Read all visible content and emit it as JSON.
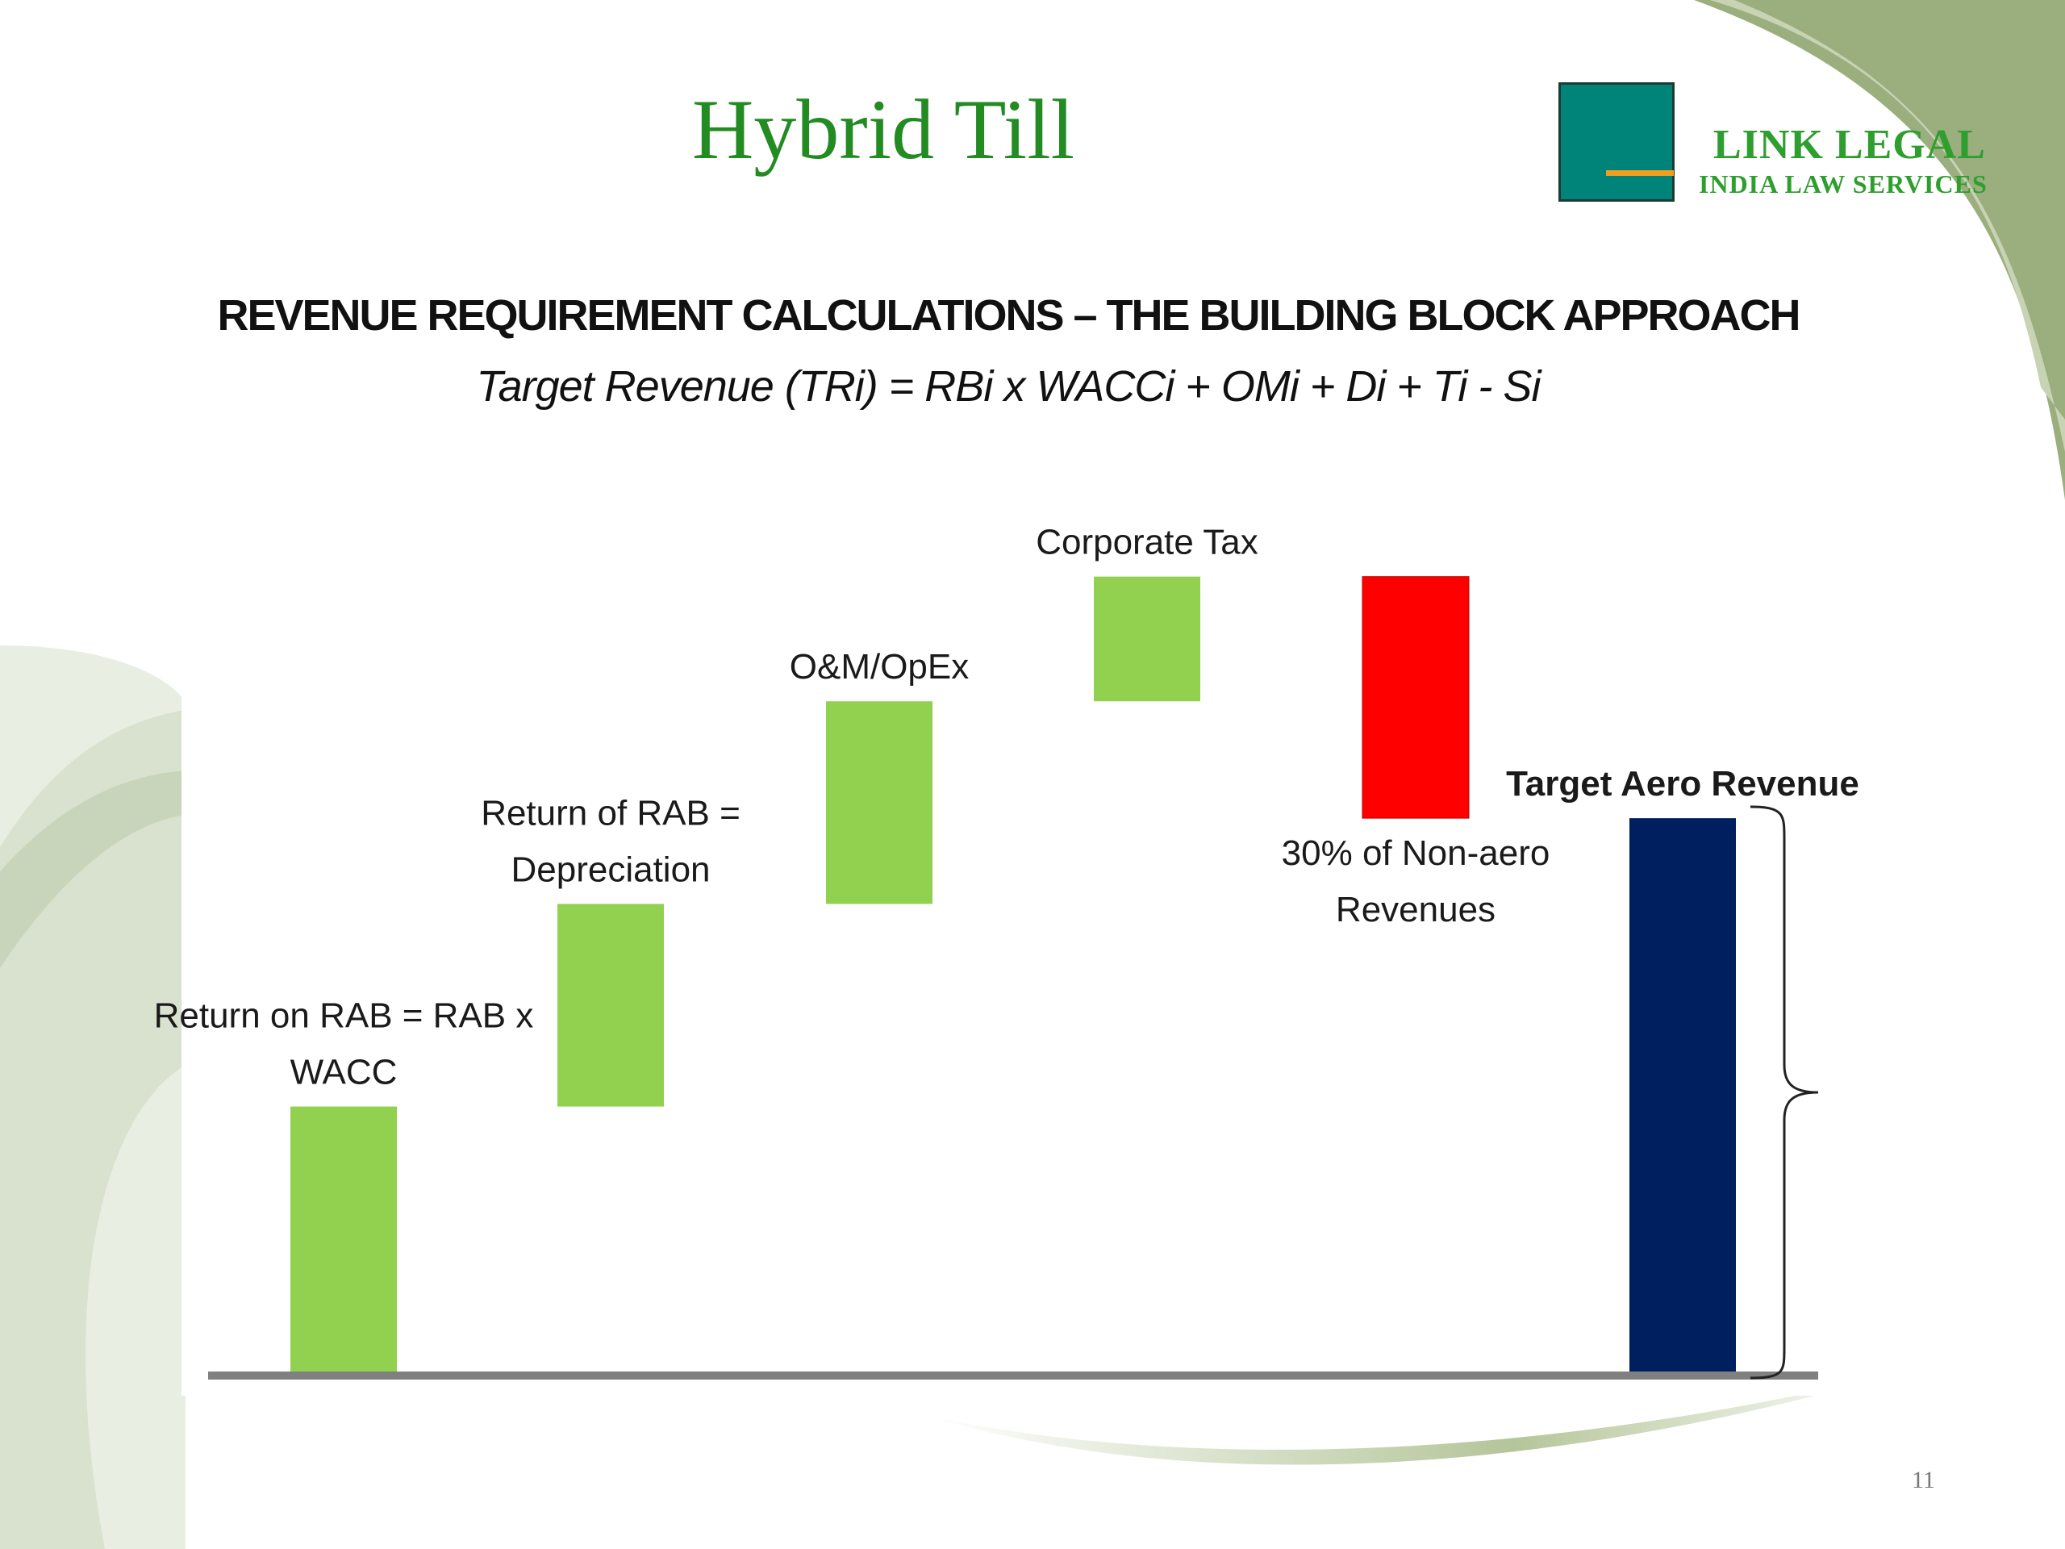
{
  "slide": {
    "title": "Hybrid Till",
    "page_number": "11"
  },
  "brand": {
    "name": "LINK LEGAL",
    "subtitle": "INDIA LAW  SERVICES"
  },
  "colors": {
    "title_green": "#228b22",
    "bar_green": "#92d050",
    "bar_red": "#ff0000",
    "bar_navy": "#001f5f",
    "baseline": "#808080"
  },
  "chart_data": {
    "type": "bar",
    "subtype": "waterfall",
    "title": "REVENUE REQUIREMENT CALCULATIONS – THE BUILDING BLOCK APPROACH",
    "subtitle": "Target Revenue  (TRi) = RBi x WACCi + OMi + Di + Ti - Si",
    "xlabel": "",
    "ylabel": "",
    "ylim": [
      0,
      100
    ],
    "grid": false,
    "legend": "none",
    "categories": [
      "Return on RAB = RAB x WACC",
      "Return of RAB = Depreciation",
      "O&M/OpEx",
      "Corporate Tax",
      "30% of Non-aero Revenues",
      "Target Aero Revenue"
    ],
    "label_lines": [
      [
        "Return on RAB = RAB x",
        "WACC"
      ],
      [
        "Return of RAB =",
        "Depreciation"
      ],
      [
        "O&M/OpEx"
      ],
      [
        "Corporate Tax"
      ],
      [
        "30% of Non-aero",
        "Revenues"
      ],
      [
        "Target Aero Revenue"
      ]
    ],
    "label_position": [
      "above",
      "above",
      "above",
      "above",
      "below",
      "above"
    ],
    "label_bold": [
      false,
      false,
      false,
      false,
      false,
      true
    ],
    "bars": [
      {
        "base": 0,
        "value": 34,
        "kind": "increase"
      },
      {
        "base": 34,
        "value": 26,
        "kind": "increase"
      },
      {
        "base": 60,
        "value": 26,
        "kind": "increase"
      },
      {
        "base": 86,
        "value": 16,
        "kind": "increase"
      },
      {
        "base": 102,
        "value": -31,
        "kind": "decrease"
      },
      {
        "base": 0,
        "value": 71,
        "kind": "total"
      }
    ]
  }
}
